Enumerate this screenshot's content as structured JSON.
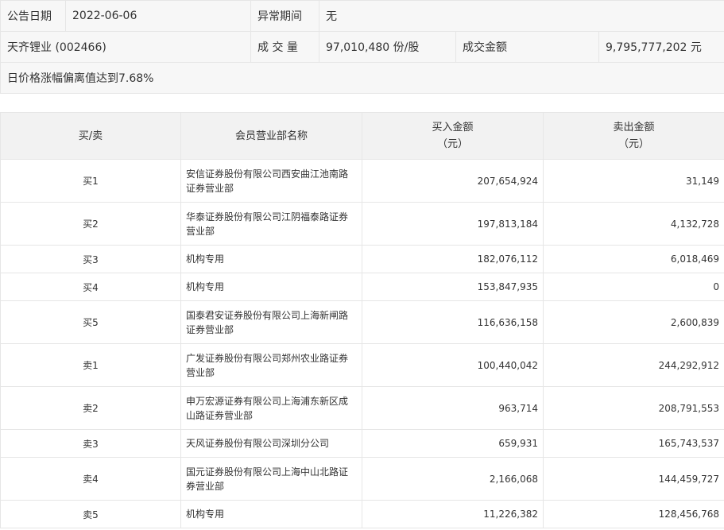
{
  "info": {
    "date_label": "公告日期",
    "date_value": "2022-06-06",
    "period_label": "异常期间",
    "period_value": "无",
    "stock_name": "天齐锂业 (002466)",
    "volume_label": "成 交 量",
    "volume_value": "97,010,480 份/股",
    "amount_label": "成交金额",
    "amount_value": "9,795,777,202 元",
    "reason": "日价格涨幅偏离值达到7.68%"
  },
  "table": {
    "headers": {
      "side": "买/卖",
      "branch": "会员营业部名称",
      "buy": "买入金额",
      "buy_unit": "（元）",
      "sell": "卖出金额",
      "sell_unit": "（元）"
    },
    "rows": [
      {
        "side": "买1",
        "branch": "安信证券股份有限公司西安曲江池南路证券营业部",
        "buy": "207,654,924",
        "sell": "31,149"
      },
      {
        "side": "买2",
        "branch": "华泰证券股份有限公司江阴福泰路证券营业部",
        "buy": "197,813,184",
        "sell": "4,132,728"
      },
      {
        "side": "买3",
        "branch": "机构专用",
        "buy": "182,076,112",
        "sell": "6,018,469"
      },
      {
        "side": "买4",
        "branch": "机构专用",
        "buy": "153,847,935",
        "sell": "0"
      },
      {
        "side": "买5",
        "branch": "国泰君安证券股份有限公司上海新闸路证券营业部",
        "buy": "116,636,158",
        "sell": "2,600,839"
      },
      {
        "side": "卖1",
        "branch": "广发证券股份有限公司郑州农业路证券营业部",
        "buy": "100,440,042",
        "sell": "244,292,912"
      },
      {
        "side": "卖2",
        "branch": "申万宏源证券有限公司上海浦东新区成山路证券营业部",
        "buy": "963,714",
        "sell": "208,791,553"
      },
      {
        "side": "卖3",
        "branch": "天风证券股份有限公司深圳分公司",
        "buy": "659,931",
        "sell": "165,743,537"
      },
      {
        "side": "卖4",
        "branch": "国元证券股份有限公司上海中山北路证券营业部",
        "buy": "2,166,068",
        "sell": "144,459,727"
      },
      {
        "side": "卖5",
        "branch": "机构专用",
        "buy": "11,226,382",
        "sell": "128,456,768"
      }
    ]
  }
}
